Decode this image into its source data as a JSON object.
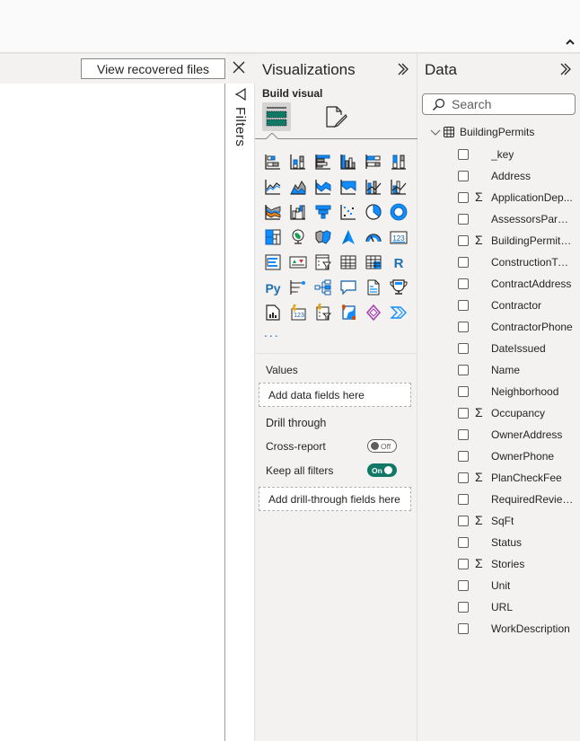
{
  "ribbon": {
    "collapse_icon": "chevron-up-icon"
  },
  "notification": {
    "recover_label": "View recovered files",
    "close_icon": "close-icon"
  },
  "filters": {
    "label": "Filters",
    "icon": "filter-icon"
  },
  "visualizations": {
    "title": "Visualizations",
    "expand_icon": "double-chevron-right-icon",
    "build_visual_label": "Build visual",
    "tabs": [
      {
        "name": "build-visual-tab",
        "icon": "fields-icon",
        "active": true
      },
      {
        "name": "format-visual-tab",
        "icon": "format-brush-icon",
        "active": false
      }
    ],
    "icons": [
      "stacked-bar-chart",
      "stacked-column-chart",
      "clustered-bar-chart",
      "clustered-column-chart",
      "100-stacked-bar-chart",
      "100-stacked-column-chart",
      "line-chart",
      "area-chart",
      "stacked-area-chart",
      "100-stacked-area-chart",
      "line-and-stacked-column-chart",
      "line-and-clustered-column-chart",
      "ribbon-chart",
      "waterfall-chart",
      "funnel-chart",
      "scatter-chart",
      "pie-chart",
      "donut-chart",
      "treemap",
      "map",
      "filled-map",
      "azure-map",
      "gauge",
      "card",
      "multi-row-card",
      "kpi",
      "slicer",
      "table",
      "matrix",
      "r-script-visual",
      "python-visual",
      "key-influencers",
      "decomposition-tree",
      "qa-visual",
      "smart-narrative",
      "metrics",
      "paginated-report",
      "power-apps-card",
      "power-apps-slicer",
      "arcgis-map",
      "power-apps",
      "power-automate"
    ],
    "more_label": "...",
    "values_label": "Values",
    "values_placeholder": "Add data fields here",
    "drill_through_label": "Drill through",
    "cross_report_label": "Cross-report",
    "cross_report_state": "Off",
    "keep_filters_label": "Keep all filters",
    "keep_filters_state": "On",
    "drill_placeholder": "Add drill-through fields here"
  },
  "data": {
    "title": "Data",
    "expand_icon": "double-chevron-right-icon",
    "search_placeholder": "Search",
    "table_name": "BuildingPermits",
    "fields": [
      {
        "name": "_key",
        "sigma": false
      },
      {
        "name": "Address",
        "sigma": false
      },
      {
        "name": "ApplicationDep...",
        "sigma": true
      },
      {
        "name": "AssessorsParcel...",
        "sigma": false
      },
      {
        "name": "BuildingPermitF...",
        "sigma": true
      },
      {
        "name": "ConstructionType",
        "sigma": false
      },
      {
        "name": "ContractAddress",
        "sigma": false
      },
      {
        "name": "Contractor",
        "sigma": false
      },
      {
        "name": "ContractorPhone",
        "sigma": false
      },
      {
        "name": "DateIssued",
        "sigma": false
      },
      {
        "name": "Name",
        "sigma": false
      },
      {
        "name": "Neighborhood",
        "sigma": false
      },
      {
        "name": "Occupancy",
        "sigma": true
      },
      {
        "name": "OwnerAddress",
        "sigma": false
      },
      {
        "name": "OwnerPhone",
        "sigma": false
      },
      {
        "name": "PlanCheckFee",
        "sigma": true
      },
      {
        "name": "RequiredReviews",
        "sigma": false
      },
      {
        "name": "SqFt",
        "sigma": true
      },
      {
        "name": "Status",
        "sigma": false
      },
      {
        "name": "Stories",
        "sigma": true
      },
      {
        "name": "Unit",
        "sigma": false
      },
      {
        "name": "URL",
        "sigma": false
      },
      {
        "name": "WorkDescription",
        "sigma": false
      }
    ],
    "sigma_symbol": "Σ"
  },
  "colors": {
    "accent_blue": "#118dff",
    "teal": "#117865",
    "gray": "#605e5c"
  }
}
